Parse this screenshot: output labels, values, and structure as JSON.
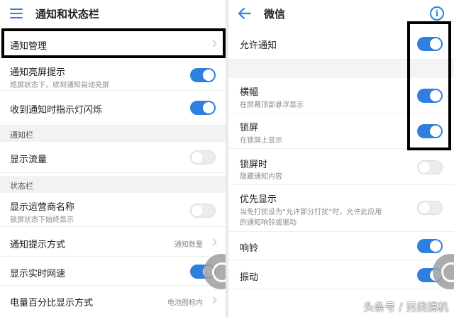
{
  "left": {
    "title": "通知和状态栏",
    "rows": {
      "notif_mgmt": "通知管理",
      "notif_screen": "通知亮屏提示",
      "notif_screen_sub": "熄屏状态下，收到通知自动亮屏",
      "led": "收到通知时指示灯闪烁",
      "section_notif": "通知栏",
      "show_traffic": "显示流量",
      "section_status": "状态栏",
      "carrier": "显示运营商名称",
      "carrier_sub": "锁屏状态下始终显示",
      "notif_style": "通知提示方式",
      "notif_style_value": "通知数量",
      "net_speed": "显示实时网速",
      "battery_pct": "电量百分比显示方式",
      "battery_pct_value": "电池图标内"
    }
  },
  "right": {
    "title": "微信",
    "rows": {
      "allow": "允许通知",
      "banner": "横幅",
      "banner_sub": "在屏幕顶部悬浮显示",
      "lock": "锁屏",
      "lock_sub": "在锁屏上显示",
      "lock_time": "锁屏时",
      "lock_time_sub": "隐藏通知内容",
      "priority": "优先显示",
      "priority_sub_1": "当免打扰设为“允许部分打扰”时，允许此应用",
      "priority_sub_2": "的通知响铃或振动",
      "ring": "响铃",
      "vibrate": "振动"
    }
  },
  "toggles": {
    "notif_screen": true,
    "led": true,
    "show_traffic": false,
    "carrier": false,
    "net_speed": true,
    "allow": true,
    "banner": true,
    "lock": true,
    "lock_time": false,
    "priority": false,
    "ring": true,
    "vibrate": true
  },
  "watermark": "头条号 / 另类搞机",
  "colors": {
    "accent": "#2f7fe0",
    "toggle_off": "#ececec",
    "section_bg": "#f2f2f2"
  },
  "icons": [
    "menu-icon",
    "back-arrow-icon",
    "info-icon",
    "chevron-right-icon",
    "floating-ball-icon"
  ]
}
